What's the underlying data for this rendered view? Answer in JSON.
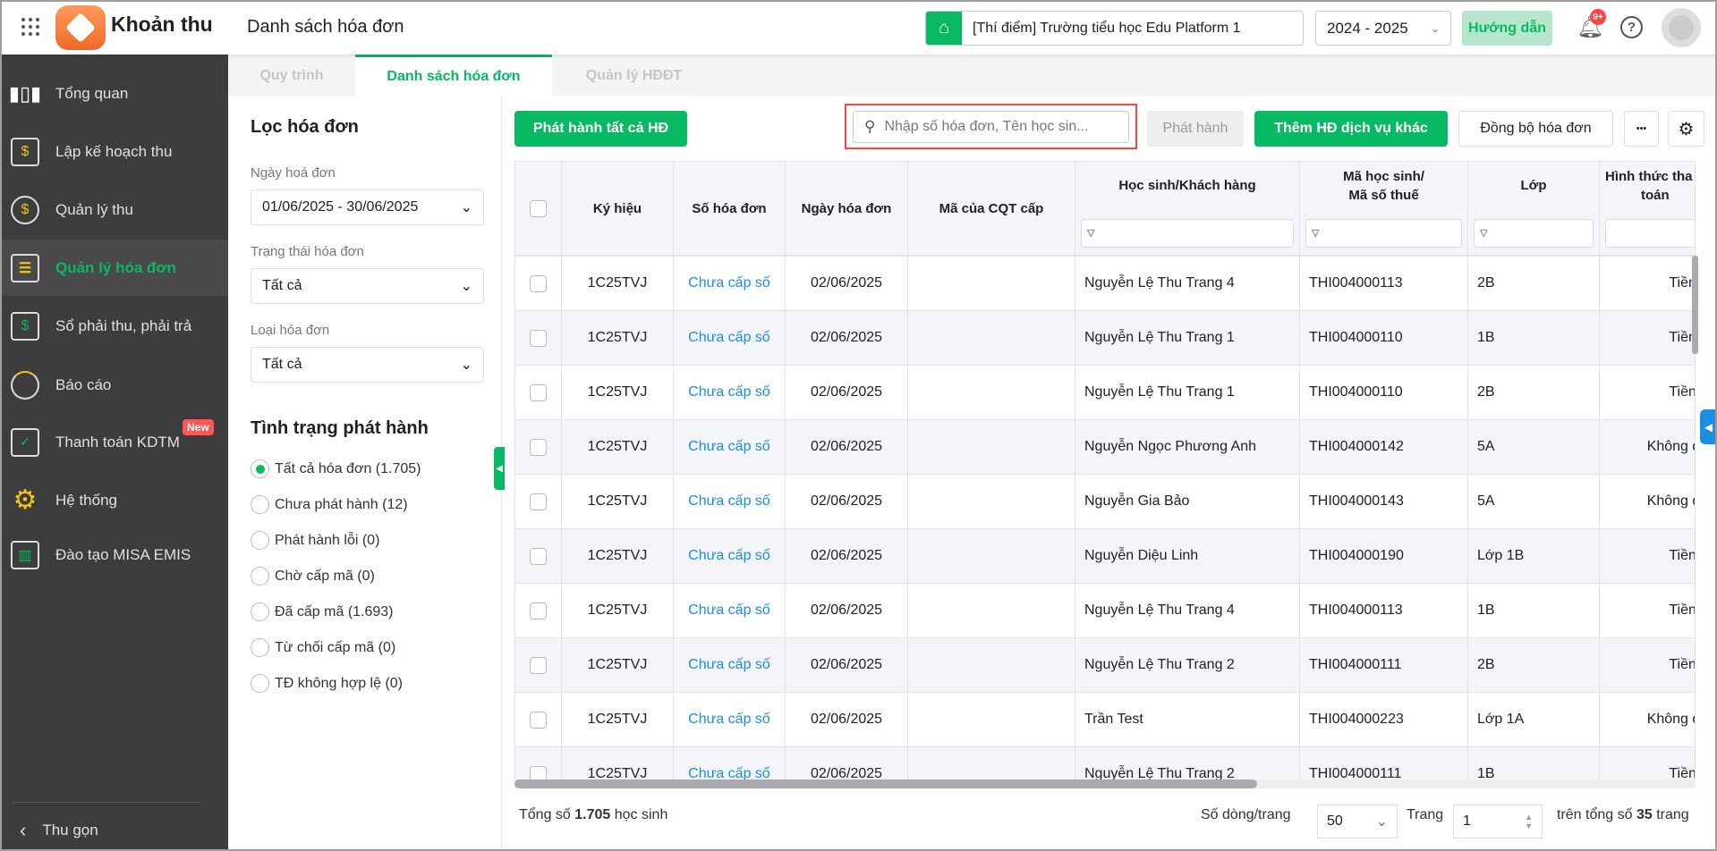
{
  "header": {
    "app_title": "Khoản thu",
    "page_title": "Danh sách hóa đơn",
    "school": "[Thí điểm] Trường tiểu học Edu Platform 1",
    "year": "2024 - 2025",
    "guide": "Hướng dẫn",
    "notif_badge": "9+",
    "help": "?"
  },
  "sidebar": {
    "items": [
      {
        "label": "Tổng quan",
        "icon": "chart-bars-icon"
      },
      {
        "label": "Lập kế hoạch thu",
        "icon": "calendar-dollar-icon"
      },
      {
        "label": "Quản lý thu",
        "icon": "hand-coin-icon"
      },
      {
        "label": "Quản lý hóa đơn",
        "icon": "document-icon",
        "active": true
      },
      {
        "label": "Sổ phải thu, phải trả",
        "icon": "ledger-book-icon"
      },
      {
        "label": "Báo cáo",
        "icon": "pie-chart-icon"
      },
      {
        "label": "Thanh toán KDTM",
        "icon": "card-check-icon",
        "badge": "New"
      },
      {
        "label": "Hệ thống",
        "icon": "gear-icon"
      },
      {
        "label": "Đào tạo MISA EMIS",
        "icon": "book-open-icon"
      }
    ],
    "collapse": "Thu gọn"
  },
  "tabs": [
    "Quy trình",
    "Danh sách hóa đơn",
    "Quản lý HĐĐT"
  ],
  "filter": {
    "title": "Lọc hóa đơn",
    "date_label": "Ngày hoá đơn",
    "date_value": "01/06/2025 - 30/06/2025",
    "status_label": "Trạng thái hóa đơn",
    "status_value": "Tất cả",
    "type_label": "Loại hóa đơn",
    "type_value": "Tất cả",
    "issue_title": "Tình trạng phát hành",
    "options": [
      "Tất cả hóa đơn (1.705)",
      "Chưa phát hành (12)",
      "Phát hành lỗi (0)",
      "Chờ cấp mã (0)",
      "Đã cấp mã (1.693)",
      "Từ chối cấp mã (0)",
      "TĐ không hợp lệ (0)"
    ]
  },
  "toolbar": {
    "issue_all": "Phát hành tất cả HĐ",
    "search_placeholder": "Nhập số hóa đơn, Tên học sin...",
    "issue": "Phát hành",
    "add_other": "Thêm HĐ dịch vụ khác",
    "sync": "Đồng bộ hóa đơn",
    "more": "•••"
  },
  "table": {
    "headers": [
      "Ký hiệu",
      "Số hóa đơn",
      "Ngày hóa đơn",
      "Mã của CQT cấp",
      "Học sinh/Khách hàng",
      "Mã học sinh/",
      "Mã số thuế",
      "Lớp",
      "Hình thức tha",
      "toán"
    ],
    "rows": [
      [
        "1C25TVJ",
        "Chưa cấp số",
        "02/06/2025",
        "",
        "Nguyễn Lệ Thu Trang 4",
        "THI004000113",
        "2B",
        "Tiền mặt"
      ],
      [
        "1C25TVJ",
        "Chưa cấp số",
        "02/06/2025",
        "",
        "Nguyễn Lệ Thu Trang 1",
        "THI004000110",
        "1B",
        "Tiền mặt"
      ],
      [
        "1C25TVJ",
        "Chưa cấp số",
        "02/06/2025",
        "",
        "Nguyễn Lệ Thu Trang 1",
        "THI004000110",
        "2B",
        "Tiền mặt"
      ],
      [
        "1C25TVJ",
        "Chưa cấp số",
        "02/06/2025",
        "",
        "Nguyễn Ngọc Phương Anh",
        "THI004000142",
        "5A",
        "Không đăng"
      ],
      [
        "1C25TVJ",
        "Chưa cấp số",
        "02/06/2025",
        "",
        "Nguyễn Gia Bảo",
        "THI004000143",
        "5A",
        "Không đăng"
      ],
      [
        "1C25TVJ",
        "Chưa cấp số",
        "02/06/2025",
        "",
        "Nguyễn Diệu Linh",
        "THI004000190",
        "Lớp 1B",
        "Tiền mặt"
      ],
      [
        "1C25TVJ",
        "Chưa cấp số",
        "02/06/2025",
        "",
        "Nguyễn Lệ Thu Trang 4",
        "THI004000113",
        "1B",
        "Tiền mặt"
      ],
      [
        "1C25TVJ",
        "Chưa cấp số",
        "02/06/2025",
        "",
        "Nguyễn Lệ Thu Trang 2",
        "THI004000111",
        "2B",
        "Tiền mặt"
      ],
      [
        "1C25TVJ",
        "Chưa cấp số",
        "02/06/2025",
        "",
        "Trần Test",
        "THI004000223",
        "Lớp 1A",
        "Không đăng"
      ],
      [
        "1C25TVJ",
        "Chưa cấp số",
        "02/06/2025",
        "",
        "Nguyễn Lệ Thu Trang 2",
        "THI004000111",
        "1B",
        "Tiền mặt"
      ]
    ]
  },
  "footer": {
    "total_prefix": "Tổng số ",
    "total": "1.705",
    "total_suffix": " học sinh",
    "rows_label": "Số dòng/trang",
    "rows_value": "50",
    "page_label": "Trang",
    "page_value": "1",
    "of_prefix": "trên tổng số ",
    "pages": "35",
    "of_suffix": " trang"
  }
}
